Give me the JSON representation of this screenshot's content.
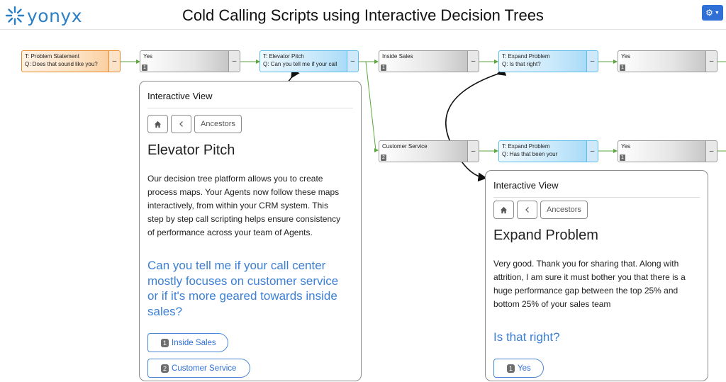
{
  "header": {
    "logo_text": "yonyx",
    "title": "Cold Calling Scripts using Interactive Decision Trees"
  },
  "colors": {
    "brand": "#2b7fc4",
    "link": "#3b7fd6",
    "root_border": "#e88a2b",
    "question_border": "#5bbde8",
    "answer_border": "#9a9a9a",
    "connector": "#5aa73c"
  },
  "tree": {
    "nodes": [
      {
        "id": "n1",
        "kind": "root",
        "line1": "T: Problem Statement",
        "line2": "Q: Does that sound like you?",
        "toggle": "–"
      },
      {
        "id": "n2",
        "kind": "answer",
        "line1": "Yes",
        "badge": "1",
        "toggle": "–"
      },
      {
        "id": "n3",
        "kind": "question",
        "line1": "T: Elevator Pitch",
        "line2": "Q: Can you tell me if your call",
        "toggle": "–"
      },
      {
        "id": "n4",
        "kind": "answer",
        "line1": "Inside Sales",
        "badge": "1",
        "toggle": "–"
      },
      {
        "id": "n5",
        "kind": "question",
        "line1": "T: Expand Problem",
        "line2": "Q: Is that right?",
        "toggle": "–"
      },
      {
        "id": "n6",
        "kind": "answer",
        "line1": "Yes",
        "badge": "1",
        "toggle": "–"
      },
      {
        "id": "n7",
        "kind": "answer",
        "line1": "Customer Service",
        "badge": "2",
        "toggle": "–"
      },
      {
        "id": "n8",
        "kind": "question",
        "line1": "T: Expand Problem",
        "line2": "Q: Has that been your",
        "toggle": "–"
      },
      {
        "id": "n9",
        "kind": "answer",
        "line1": "Yes",
        "badge": "1",
        "toggle": "–"
      }
    ]
  },
  "panel_left": {
    "heading": "Interactive View",
    "nav": {
      "home_icon": "home-icon",
      "back_icon": "chevron-left-icon",
      "ancestors_label": "Ancestors"
    },
    "title": "Elevator Pitch",
    "lines": [
      "Our decision tree platform allows you to create",
      "process maps. Your Agents now follow these maps",
      "interactively, from within your CRM system. This",
      "step by step call scripting helps ensure consistency",
      "of performance across your team of Agents."
    ],
    "question_lines": [
      "Can you tell me if your call center",
      "mostly focuses on customer service",
      "or if it's more geared towards inside",
      "sales?"
    ],
    "answers": [
      {
        "num": "1",
        "label": "Inside Sales"
      },
      {
        "num": "2",
        "label": "Customer Service"
      }
    ]
  },
  "panel_right": {
    "heading": "Interactive View",
    "nav": {
      "home_icon": "home-icon",
      "back_icon": "chevron-left-icon",
      "ancestors_label": "Ancestors"
    },
    "title": "Expand Problem",
    "lines": [
      "Very good. Thank you for sharing that. Along with",
      "attrition, I am sure it must bother you that there is a",
      "huge performance gap between the top 25% and",
      "bottom 25% of your sales team"
    ],
    "question_lines": [
      "Is that right?"
    ],
    "answers": [
      {
        "num": "1",
        "label": "Yes"
      }
    ]
  }
}
